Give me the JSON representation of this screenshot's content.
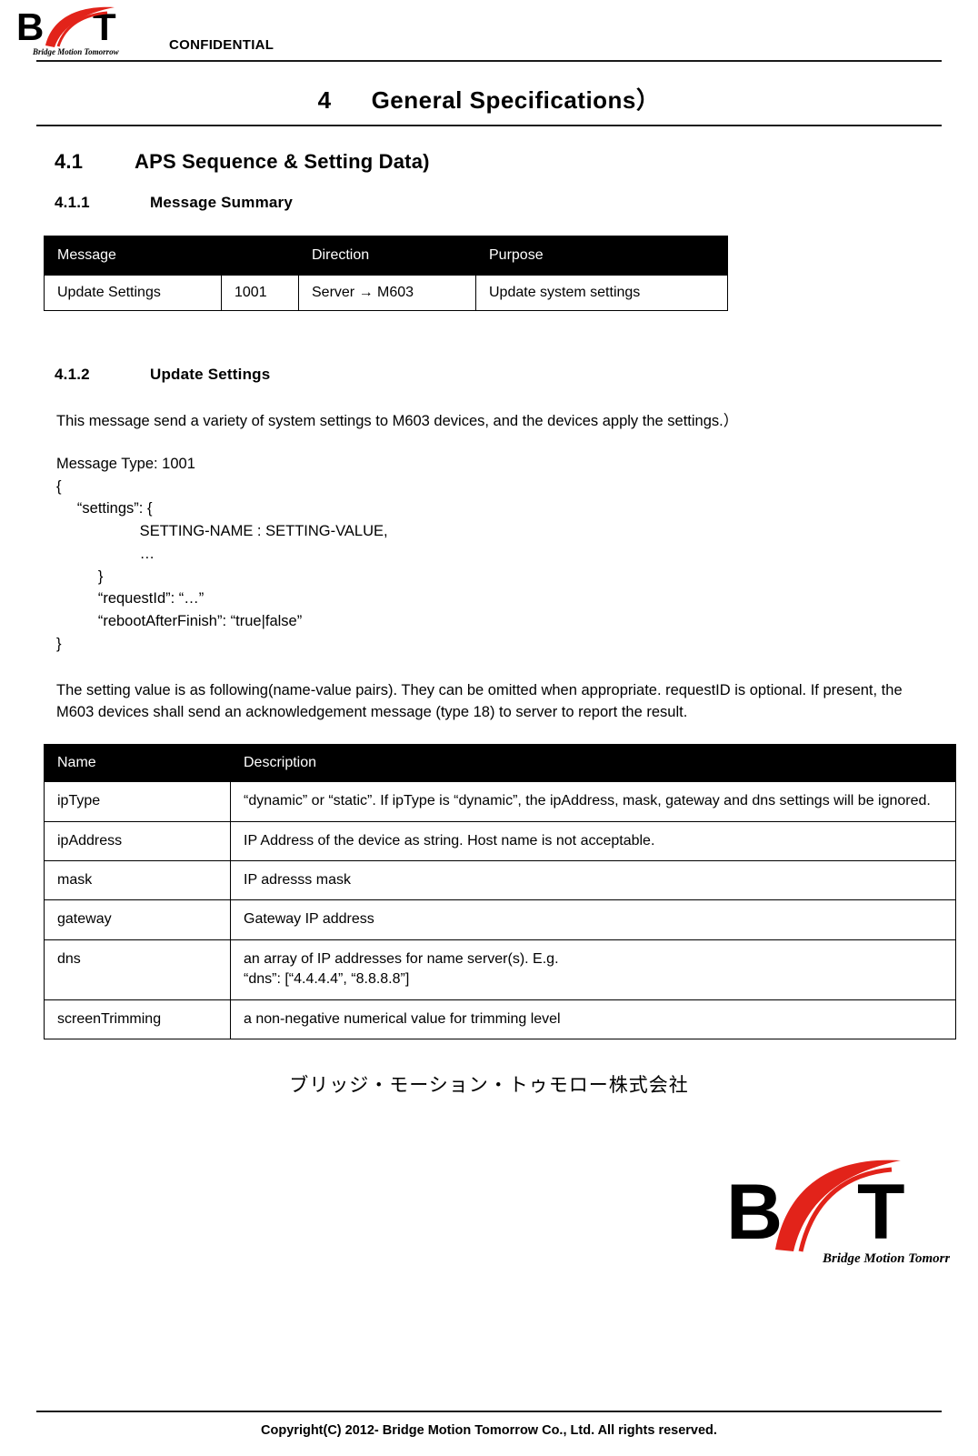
{
  "header": {
    "confidential": "CONFIDENTIAL",
    "logo_letters": "BMT",
    "logo_tagline": "Bridge Motion Tomorrow"
  },
  "title": {
    "number": "4",
    "text": "General Specifications）"
  },
  "section_4_1": {
    "number": "4.1",
    "text": "APS Sequence & Setting Data)"
  },
  "section_4_1_1": {
    "number": "4.1.1",
    "text": "Message Summary"
  },
  "message_table": {
    "headers": [
      "Message",
      "Direction",
      "Purpose"
    ],
    "rows": [
      {
        "message": "Update Settings",
        "type": "1001",
        "direction": "Server → M603",
        "purpose": "Update system settings"
      }
    ]
  },
  "section_4_1_2": {
    "number": "4.1.2",
    "text": "Update Settings"
  },
  "intro_paragraph": "This message send a variety of system settings to M603 devices, and the devices apply the settings.）",
  "code_block": "Message Type: 1001\n{\n     “settings”: {\n                    SETTING-NAME : SETTING-VALUE,\n                    …\n          }\n          “requestId”: “…”\n          “rebootAfterFinish”: “true|false”\n}",
  "note_paragraph": "The setting value is as following(name-value pairs). They can be omitted when appropriate. requestID is optional. If present, the M603 devices shall send an acknowledgement message (type 18) to server to report the result.",
  "settings_table": {
    "headers": [
      "Name",
      "Description"
    ],
    "rows": [
      {
        "name": "ipType",
        "description": "“dynamic” or “static”. If ipType is “dynamic”, the ipAddress, mask, gateway and dns settings will be ignored."
      },
      {
        "name": "ipAddress",
        "description": "IP Address of the device as string. Host name is not acceptable."
      },
      {
        "name": "mask",
        "description": "IP adresss mask"
      },
      {
        "name": "gateway",
        "description": "Gateway IP address"
      },
      {
        "name": "dns",
        "description": "an array of IP addresses for name server(s). E.g.\n“dns”: [“4.4.4.4”, “8.8.8.8”]"
      },
      {
        "name": "screenTrimming",
        "description": "a non-negative numerical value for trimming level"
      }
    ]
  },
  "footer": {
    "company_jp": "ブリッジ・モーション・トゥモロー株式会社",
    "copyright": "Copyright(C) 2012- Bridge Motion Tomorrow Co., Ltd. All rights reserved."
  },
  "colors": {
    "header_bg": "#000000",
    "header_fg": "#ffffff",
    "accent_red": "#e2231a",
    "rule": "#1a1a1a"
  }
}
